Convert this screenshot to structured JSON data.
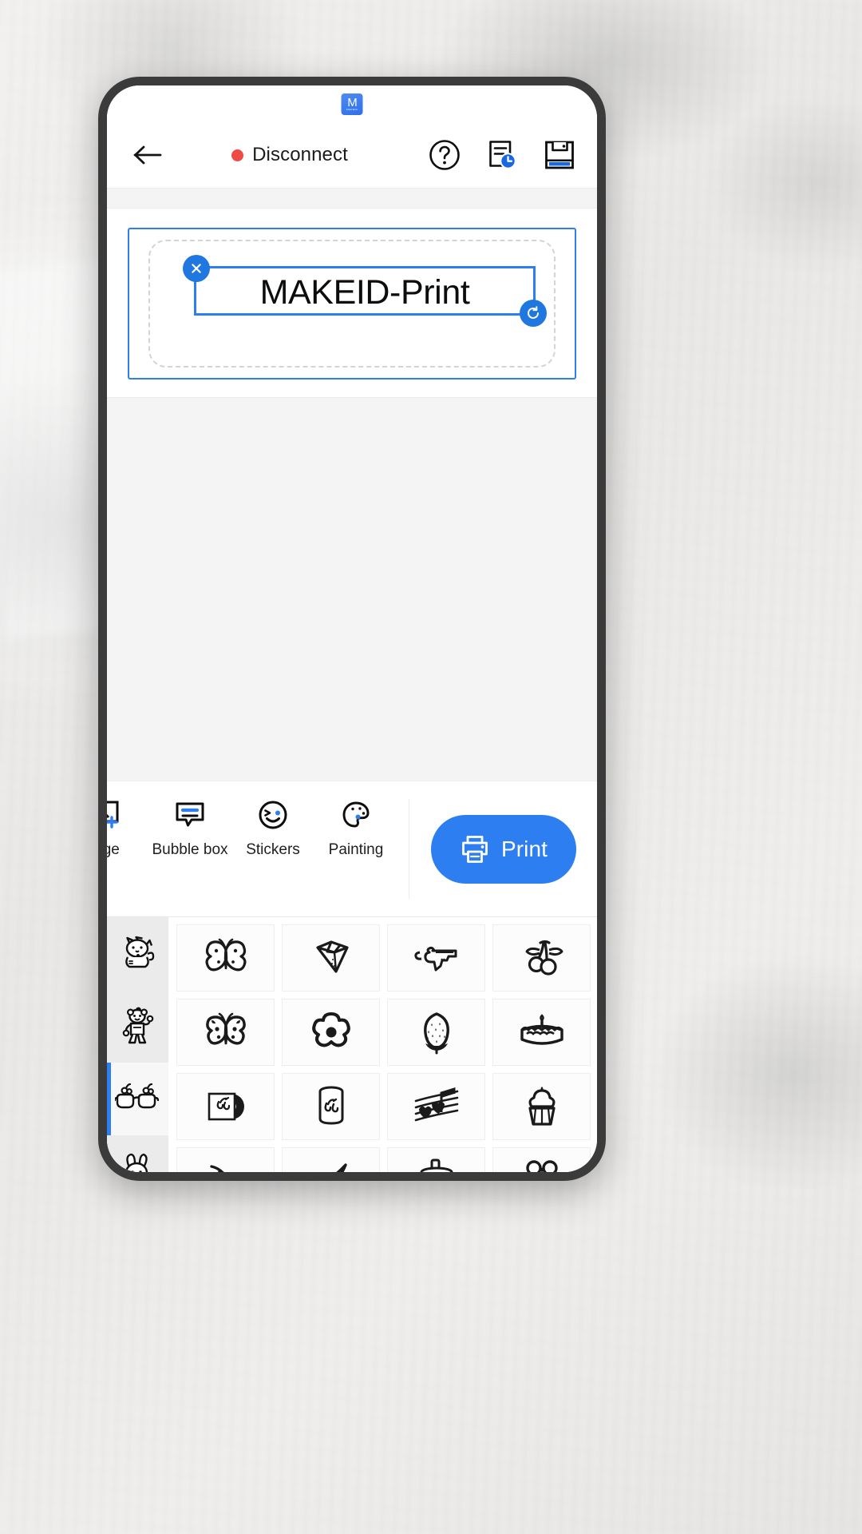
{
  "statusbar": {
    "app_badge_letter": "M",
    "app_badge_sub": "MAKEID",
    "badge_color": "#3f7ff0"
  },
  "header": {
    "back_icon": "arrow-left-icon",
    "connection_status": "Disconnect",
    "connection_dot_color": "#f04a45",
    "icons": [
      {
        "name": "help-icon",
        "label": "Help"
      },
      {
        "name": "history-icon",
        "label": "History"
      },
      {
        "name": "save-icon",
        "label": "Save"
      }
    ]
  },
  "canvas": {
    "text_object": {
      "value": "MAKEID-Print",
      "selected": true,
      "close_handle": "close-icon",
      "rotate_handle": "rotate-icon"
    },
    "selection_color": "#2d7ef0"
  },
  "toolbar": {
    "items": [
      {
        "name": "image",
        "label": "age",
        "icon": "add-image-icon"
      },
      {
        "name": "bubble-box",
        "label": "Bubble box",
        "icon": "bubble-box-icon"
      },
      {
        "name": "stickers",
        "label": "Stickers",
        "icon": "sticker-face-icon"
      },
      {
        "name": "painting",
        "label": "Painting",
        "icon": "palette-icon"
      }
    ],
    "print_label": "Print",
    "print_icon": "printer-icon",
    "print_color": "#2d7ef0"
  },
  "sticker_panel": {
    "categories": [
      {
        "name": "lucky-cat",
        "active": false
      },
      {
        "name": "bear",
        "active": false
      },
      {
        "name": "glasses",
        "active": true
      },
      {
        "name": "bunny",
        "active": false
      }
    ],
    "stickers": [
      {
        "name": "butterfly-outline"
      },
      {
        "name": "diamond"
      },
      {
        "name": "pistol"
      },
      {
        "name": "cherries"
      },
      {
        "name": "butterfly-filled"
      },
      {
        "name": "flower"
      },
      {
        "name": "strawberry"
      },
      {
        "name": "birthday-cake"
      },
      {
        "name": "vinyl-record"
      },
      {
        "name": "soda-can"
      },
      {
        "name": "music-notes-hearts"
      },
      {
        "name": "cupcake"
      },
      {
        "name": "cherry-branch"
      },
      {
        "name": "wing"
      },
      {
        "name": "bubble-tea"
      },
      {
        "name": "gift-bow"
      }
    ]
  }
}
